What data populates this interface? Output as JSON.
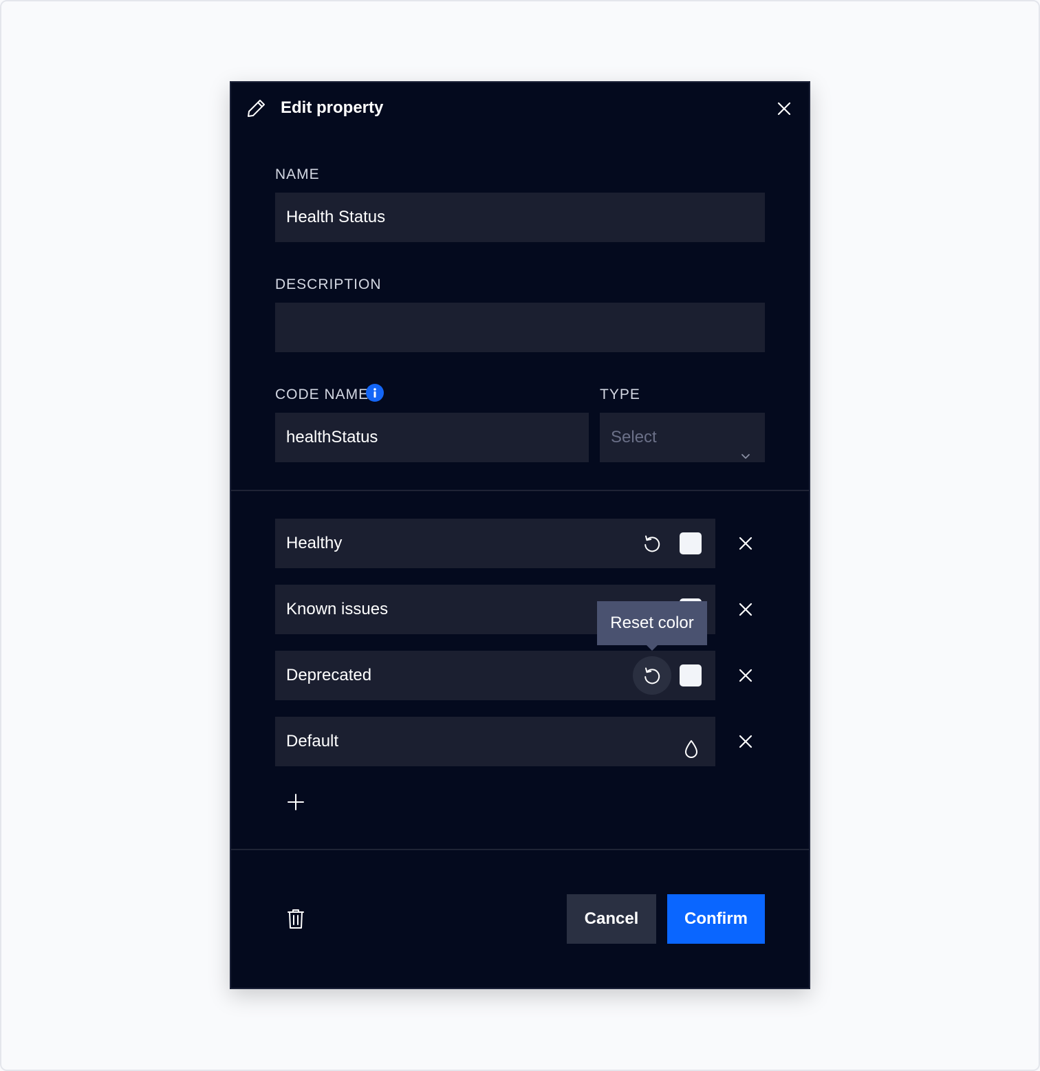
{
  "modal": {
    "title": "Edit property",
    "icons": {
      "header": "pencil-icon",
      "close": "close-icon"
    }
  },
  "fields": {
    "name": {
      "label": "NAME",
      "value": "Health Status"
    },
    "description": {
      "label": "DESCRIPTION",
      "value": ""
    },
    "code_name": {
      "label": "CODE NAME",
      "value": "healthStatus",
      "info_icon": "info-icon"
    },
    "type": {
      "label": "TYPE",
      "placeholder": "Select",
      "icon": "chevron-down-icon"
    }
  },
  "options": [
    {
      "label": "Healthy",
      "has_reset": true,
      "swatch_color": "#f2f4f9"
    },
    {
      "label": "Known issues",
      "has_reset": true,
      "swatch_color": "#f2f4f9"
    },
    {
      "label": "Deprecated",
      "has_reset": true,
      "swatch_color": "#f2f4f9"
    },
    {
      "label": "Default",
      "has_reset": false,
      "icon": "color-drop-icon"
    }
  ],
  "tooltip": {
    "text": "Reset color"
  },
  "footer": {
    "cancel_label": "Cancel",
    "confirm_label": "Confirm",
    "delete_icon": "trash-icon",
    "add_icon": "plus-icon"
  },
  "colors": {
    "modal_bg": "#040a1e",
    "field_bg": "#1b1f30",
    "accent": "#0a66ff",
    "info": "#1466f6",
    "tooltip_bg": "#4a5270",
    "cancel_bg": "#2a3042"
  }
}
